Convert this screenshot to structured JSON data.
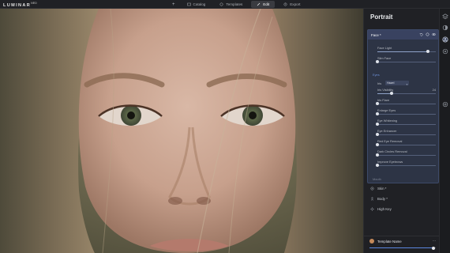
{
  "app": {
    "logo_text": "LUMINAR",
    "logo_version": "NEO"
  },
  "nav": {
    "add_label": "+",
    "items": [
      {
        "label": "Catalog",
        "icon": "catalog-icon",
        "active": false
      },
      {
        "label": "Templates",
        "icon": "templates-icon",
        "active": false
      },
      {
        "label": "Edit",
        "icon": "edit-icon",
        "active": true
      },
      {
        "label": "Export",
        "icon": "export-icon",
        "active": false
      }
    ]
  },
  "panel": {
    "title": "Portrait",
    "face": {
      "header_label": "Face *",
      "sliders_top": [
        {
          "label": "Face Light",
          "value": 0.86
        },
        {
          "label": "Slim Face",
          "value": 0.0
        }
      ],
      "eyes_section_label": "Eyes",
      "iris_label": "Iris",
      "iris_value": "Hazel",
      "sliders_eyes": [
        {
          "label": "Iris Visibility",
          "value_text": "24",
          "value": 0.24
        },
        {
          "label": "Iris Flare",
          "value_text": "",
          "value": 0.0
        },
        {
          "label": "Enlarge Eyes",
          "value_text": "",
          "value": 0.0
        },
        {
          "label": "Eye Whitening",
          "value_text": "",
          "value": 0.0
        },
        {
          "label": "Eye Enhancer",
          "value_text": "",
          "value": 0.0
        },
        {
          "label": "Red Eye Removal",
          "value_text": "",
          "value": 0.0
        },
        {
          "label": "Dark Circles Removal",
          "value_text": "",
          "value": 0.0
        },
        {
          "label": "Improve Eyebrows",
          "value_text": "",
          "value": 0.0
        }
      ]
    },
    "mouth_label": "Mouth",
    "groups": [
      {
        "label": "Skin *",
        "icon": "skin-icon"
      },
      {
        "label": "Body *",
        "icon": "body-icon"
      },
      {
        "label": "High Key",
        "icon": "highkey-icon"
      }
    ],
    "template": {
      "name": "Template Name",
      "more": "...",
      "amount": 0.96
    }
  },
  "colors": {
    "accent": "#5b87e0",
    "panel_bg": "#202125",
    "card_bg": "#2d3445"
  }
}
